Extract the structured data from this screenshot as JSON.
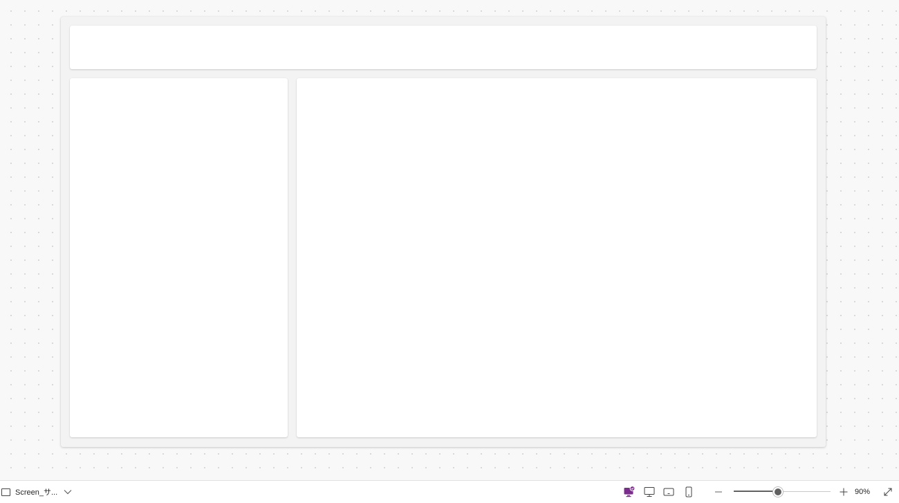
{
  "canvas": {
    "background": "#f8f8f8",
    "dot_color": "#d6d6d6",
    "screen_background": "#f3f3f3",
    "card_color": "#ffffff"
  },
  "status_bar": {
    "screen_name": "Screen_サ...",
    "screen_icon": "screen-icon",
    "dropdown_icon": "chevron-down-icon",
    "device_modes": [
      {
        "name": "teams",
        "icon": "teams-device-icon",
        "active": true,
        "color": "#7b2d8e"
      },
      {
        "name": "desktop",
        "icon": "monitor-icon",
        "active": false
      },
      {
        "name": "tablet",
        "icon": "tablet-icon",
        "active": false
      },
      {
        "name": "phone",
        "icon": "phone-icon",
        "active": false
      }
    ],
    "zoom": {
      "level_text": "90%",
      "slider_fraction": 0.46,
      "zoom_out_icon": "minus-icon",
      "zoom_in_icon": "plus-icon",
      "fit_icon": "expand-diagonal-icon"
    }
  }
}
